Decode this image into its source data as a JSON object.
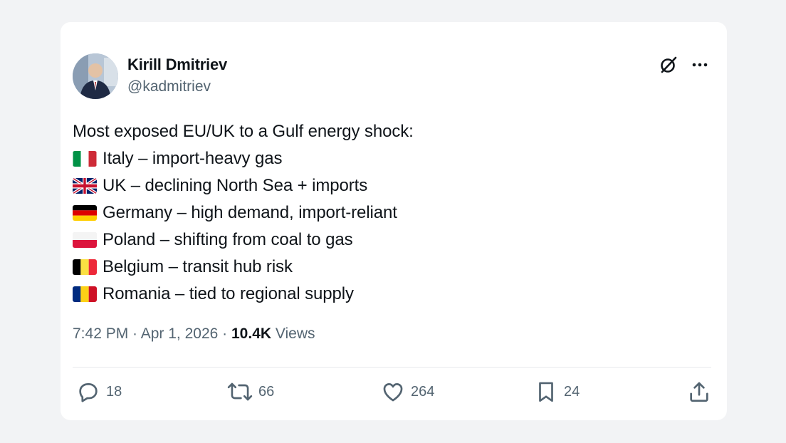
{
  "tweet": {
    "author_name": "Kirill Dmitriev",
    "author_handle": "@kadmitriev",
    "headline": "Most exposed EU/UK to a Gulf energy shock:",
    "items": [
      {
        "flag": "italy-flag",
        "text": "Italy – import-heavy gas"
      },
      {
        "flag": "uk-flag",
        "text": "UK – declining North Sea + imports"
      },
      {
        "flag": "germany-flag",
        "text": "Germany – high demand, import-reliant"
      },
      {
        "flag": "poland-flag",
        "text": "Poland – shifting from coal to gas"
      },
      {
        "flag": "belgium-flag",
        "text": "Belgium – transit hub risk"
      },
      {
        "flag": "romania-flag",
        "text": "Romania – tied to regional supply"
      }
    ],
    "time": "7:42 PM",
    "date": "Apr 1, 2026",
    "separator": " · ",
    "views_count": "10.4K",
    "views_label": "Views"
  },
  "actions": {
    "replies": "18",
    "reposts": "66",
    "likes": "264",
    "bookmarks": "24"
  },
  "icons": {
    "top_right": [
      "grok-icon",
      "more-icon"
    ],
    "actions": [
      "reply-icon",
      "repost-icon",
      "like-icon",
      "bookmark-icon",
      "share-icon"
    ]
  },
  "colors": {
    "text": "#0f1419",
    "secondary": "#536471",
    "background": "#f2f3f5",
    "card": "#ffffff"
  }
}
